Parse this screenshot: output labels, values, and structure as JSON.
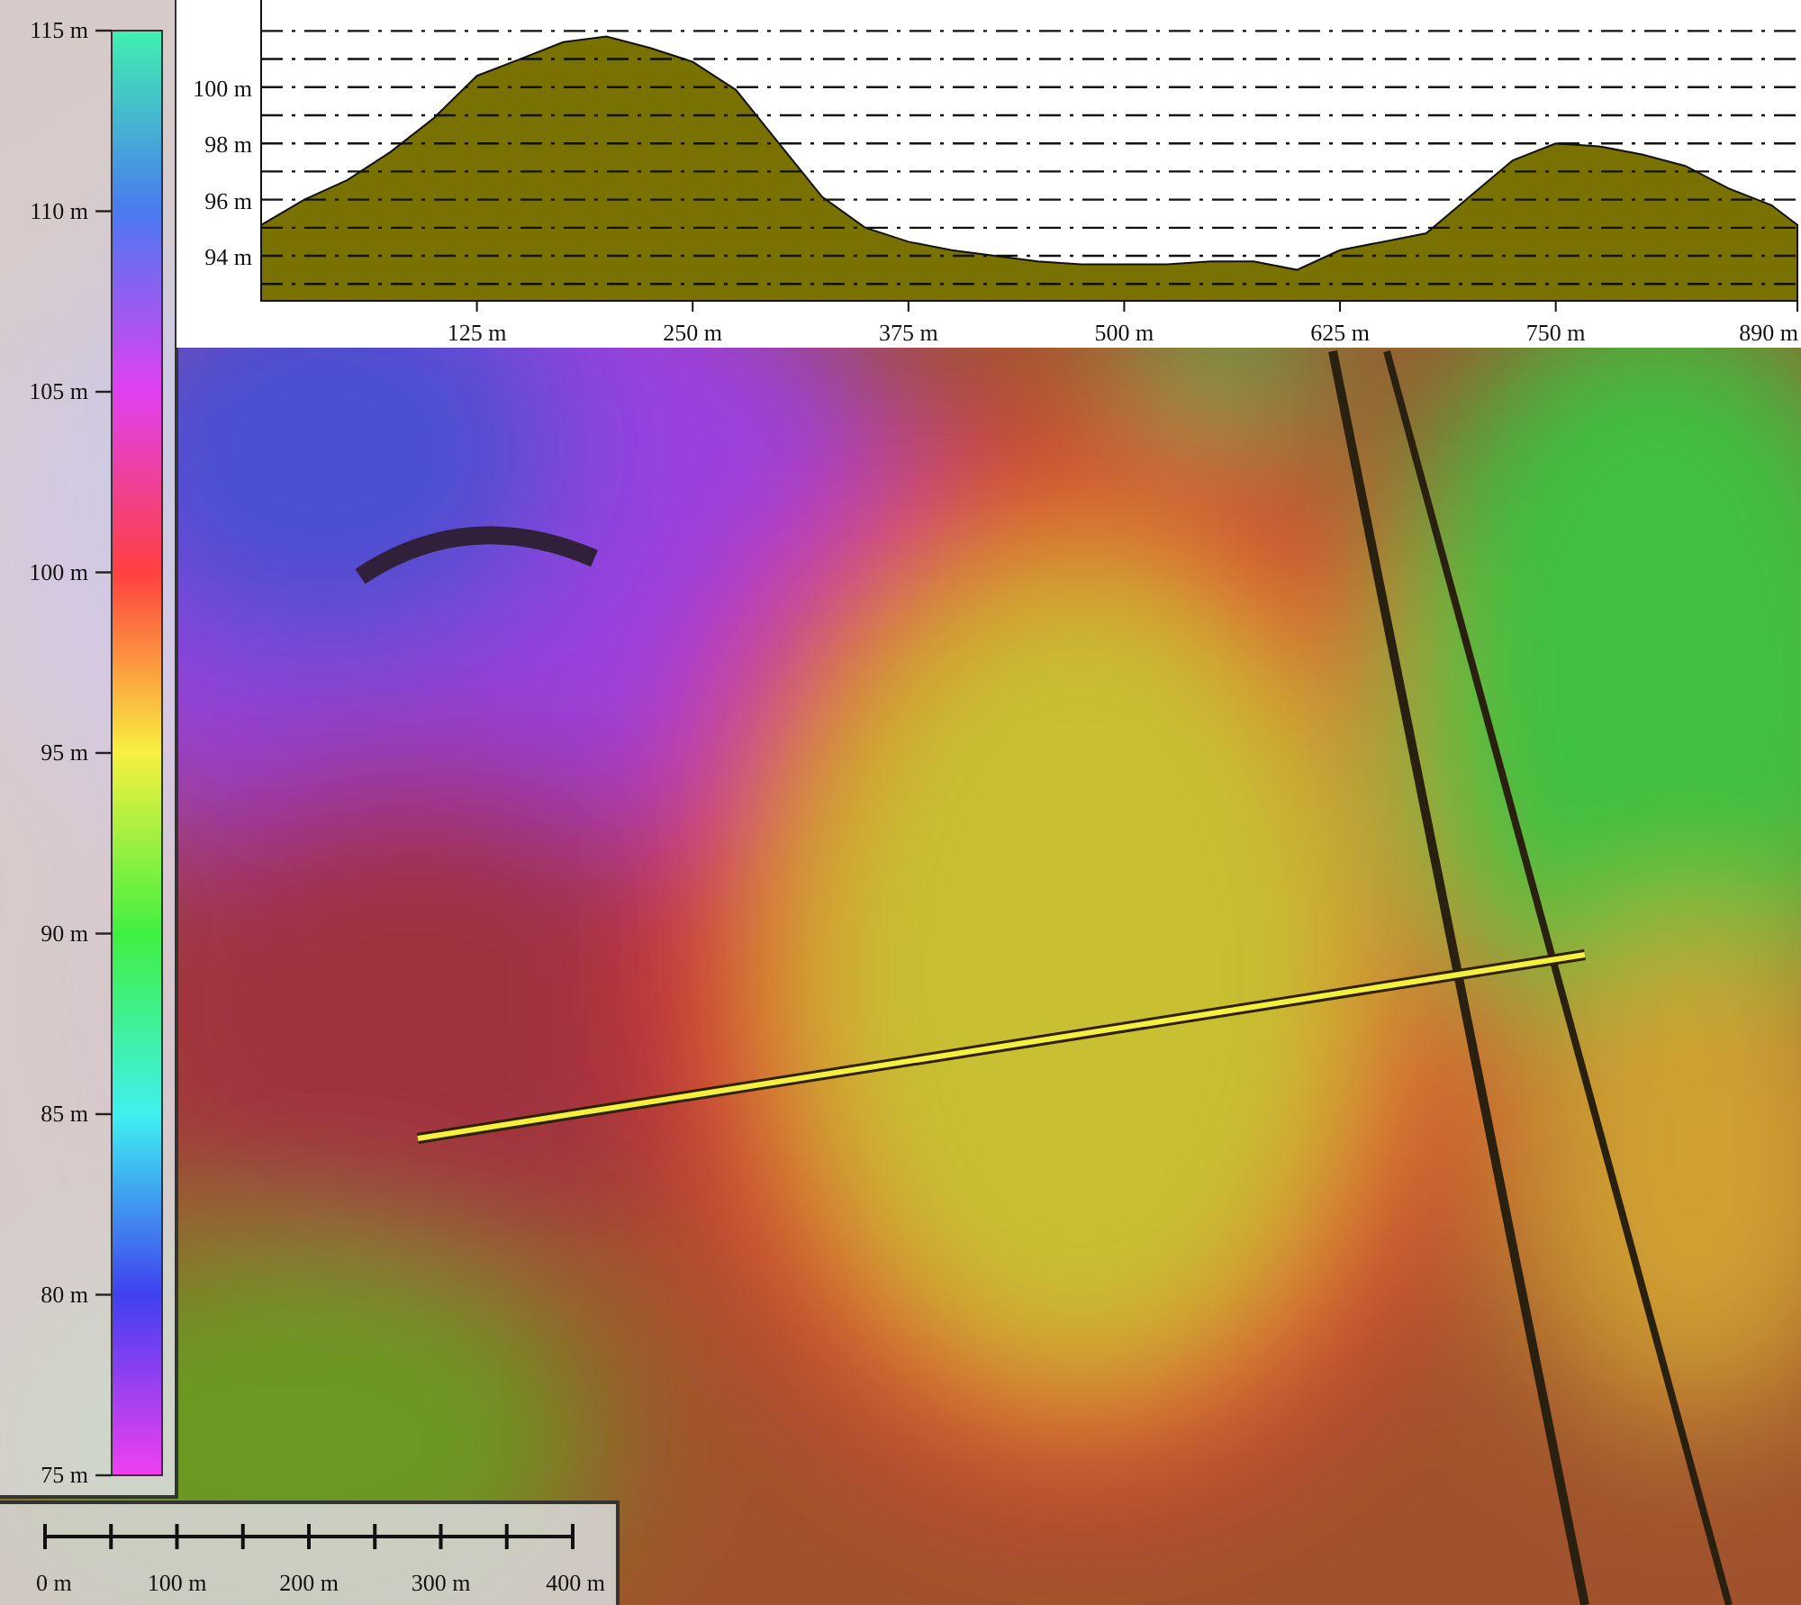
{
  "legend": {
    "labels": [
      "115 m",
      "110 m",
      "105 m",
      "100 m",
      "95 m",
      "90 m",
      "85 m",
      "80 m",
      "75 m"
    ]
  },
  "profile": {
    "chart_data": {
      "type": "area",
      "xlim": [
        0,
        890
      ],
      "ylim": [
        92.4,
        103.1
      ],
      "grid": true,
      "xticks": [
        {
          "value": 125,
          "label": "125 m"
        },
        {
          "value": 250,
          "label": "250 m"
        },
        {
          "value": 375,
          "label": "375 m"
        },
        {
          "value": 500,
          "label": "500 m"
        },
        {
          "value": 625,
          "label": "625 m"
        },
        {
          "value": 750,
          "label": "750 m"
        },
        {
          "value": 890,
          "label": "890 m"
        }
      ],
      "yticks": [
        {
          "value": 94,
          "label": "94 m"
        },
        {
          "value": 96,
          "label": "96 m"
        },
        {
          "value": 98,
          "label": "98 m"
        },
        {
          "value": 100,
          "label": "100 m"
        }
      ],
      "x": [
        0,
        25,
        50,
        75,
        100,
        125,
        150,
        175,
        200,
        225,
        250,
        275,
        300,
        325,
        350,
        375,
        400,
        425,
        450,
        475,
        500,
        525,
        550,
        575,
        600,
        625,
        650,
        675,
        700,
        725,
        750,
        775,
        800,
        825,
        850,
        875,
        890
      ],
      "series": [
        {
          "color": "#7a7200",
          "values": [
            95.1,
            96.0,
            96.7,
            97.7,
            98.9,
            100.4,
            101.0,
            101.6,
            101.8,
            101.4,
            100.9,
            99.9,
            98.0,
            96.1,
            95.0,
            94.5,
            94.2,
            94.0,
            93.8,
            93.7,
            93.7,
            93.7,
            93.8,
            93.8,
            93.5,
            94.2,
            94.5,
            94.8,
            96.1,
            97.4,
            98.0,
            97.9,
            97.6,
            97.2,
            96.4,
            95.8,
            95.1
          ]
        }
      ]
    }
  },
  "scale_bar": {
    "labels": [
      "0 m",
      "100 m",
      "200 m",
      "300 m",
      "400 m"
    ]
  }
}
